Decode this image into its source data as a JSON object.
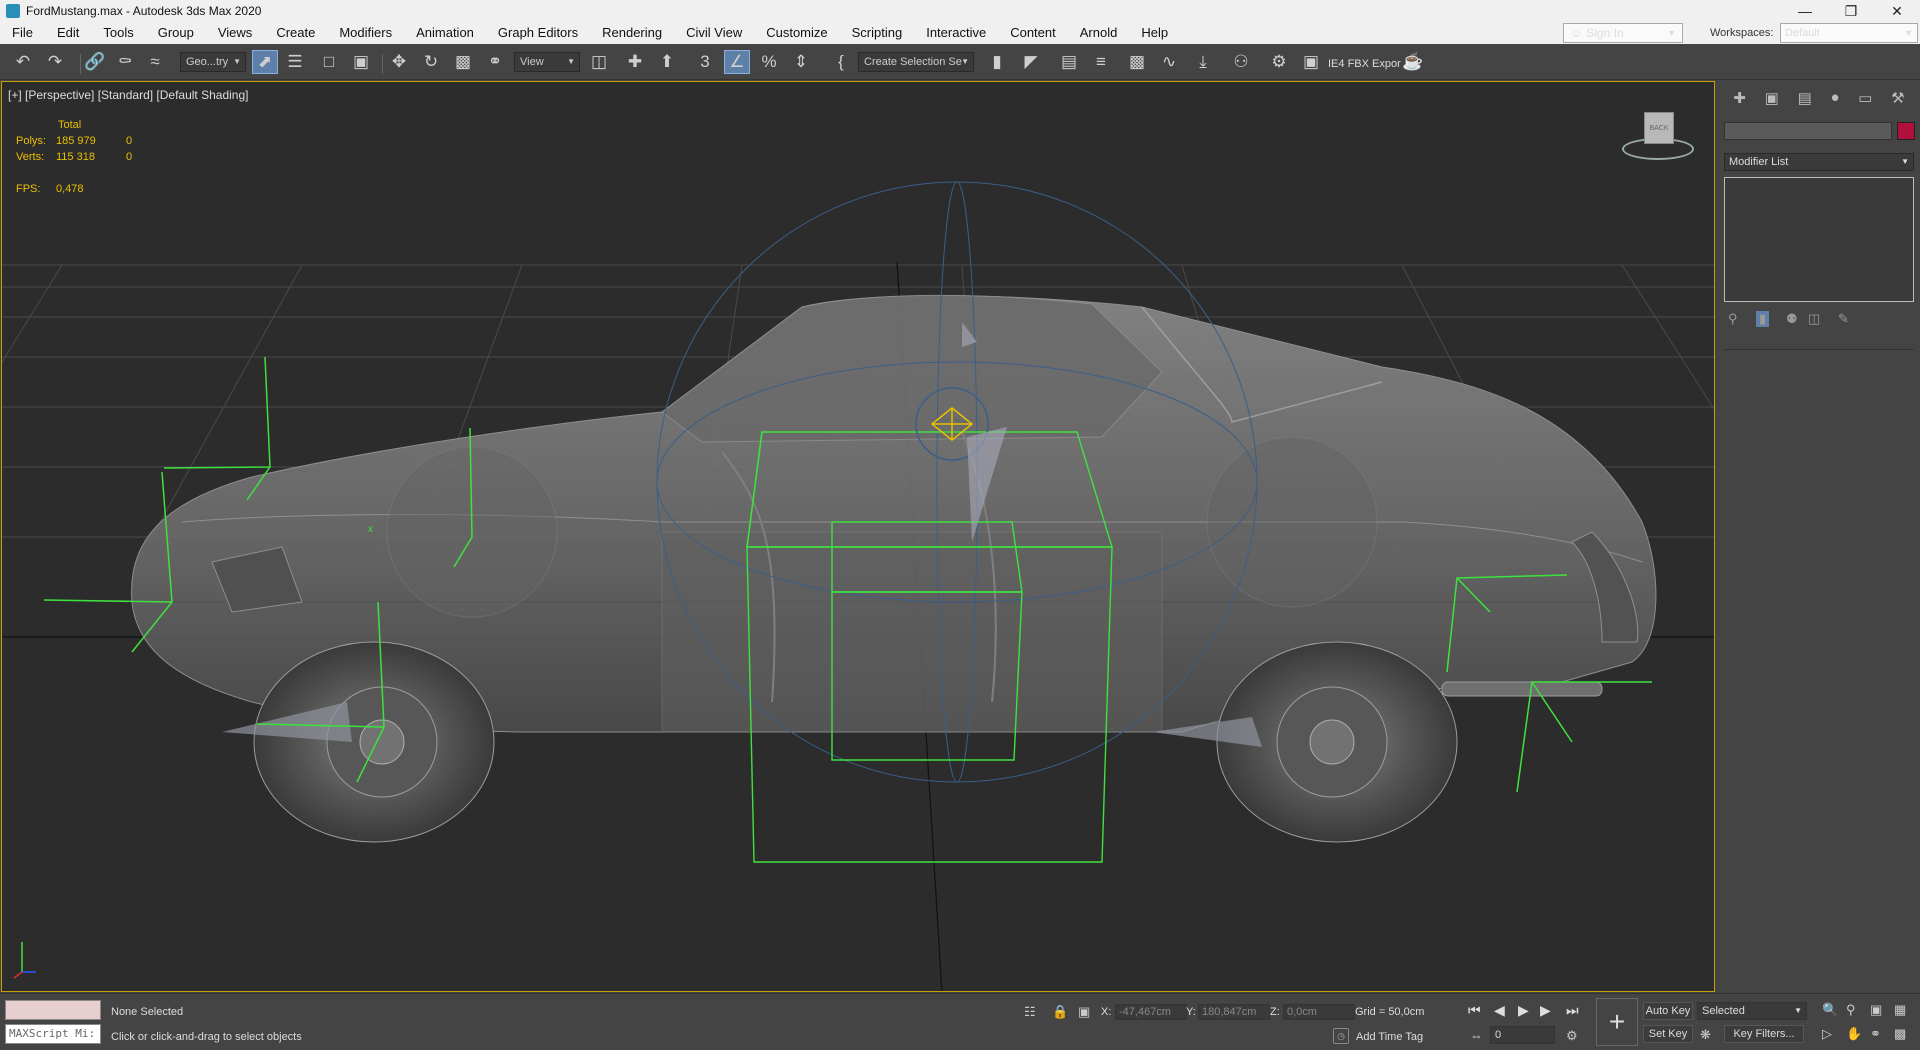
{
  "window": {
    "title": "FordMustang.max - Autodesk 3ds Max 2020",
    "minimize_icon": "minimize-icon",
    "maximize_icon": "restore-icon",
    "close_icon": "close-icon"
  },
  "menu": [
    "File",
    "Edit",
    "Tools",
    "Group",
    "Views",
    "Create",
    "Modifiers",
    "Animation",
    "Graph Editors",
    "Rendering",
    "Civil View",
    "Customize",
    "Scripting",
    "Interactive",
    "Content",
    "Arnold",
    "Help"
  ],
  "account": {
    "sign_in": "Sign In",
    "workspaces_label": "Workspaces:",
    "workspace": "Default"
  },
  "toolbar": {
    "selection_filter": "Geo...try",
    "ref_coord": "View",
    "named_selection": "Create Selection Se",
    "export_label": "IE4 FBX Expor"
  },
  "viewport": {
    "label": "[+] [Perspective] [Standard] [Default Shading]",
    "stats": {
      "header": "Total",
      "polys_label": "Polys:",
      "polys_total": "185 979",
      "polys_sel": "0",
      "verts_label": "Verts:",
      "verts_total": "115 318",
      "verts_sel": "0",
      "fps_label": "FPS:",
      "fps": "0,478"
    },
    "viewcube_label": "BACK",
    "axis_x": "x",
    "axis_y": "y",
    "axis_z": "z"
  },
  "command_panel": {
    "modifier_list": "Modifier List",
    "object_color": "#b0103c"
  },
  "status": {
    "selection": "None Selected",
    "prompt": "Click or click-and-drag to select objects",
    "maxscript": "MAXScript Mi:",
    "x_label": "X:",
    "x_value": "-47,467cm",
    "y_label": "Y:",
    "y_value": "180,847cm",
    "z_label": "Z:",
    "z_value": "0,0cm",
    "grid": "Grid = 50,0cm",
    "add_time_tag": "Add Time Tag",
    "frame": "0",
    "auto_key": "Auto Key",
    "set_key": "Set Key",
    "selected": "Selected",
    "key_filters": "Key Filters..."
  }
}
